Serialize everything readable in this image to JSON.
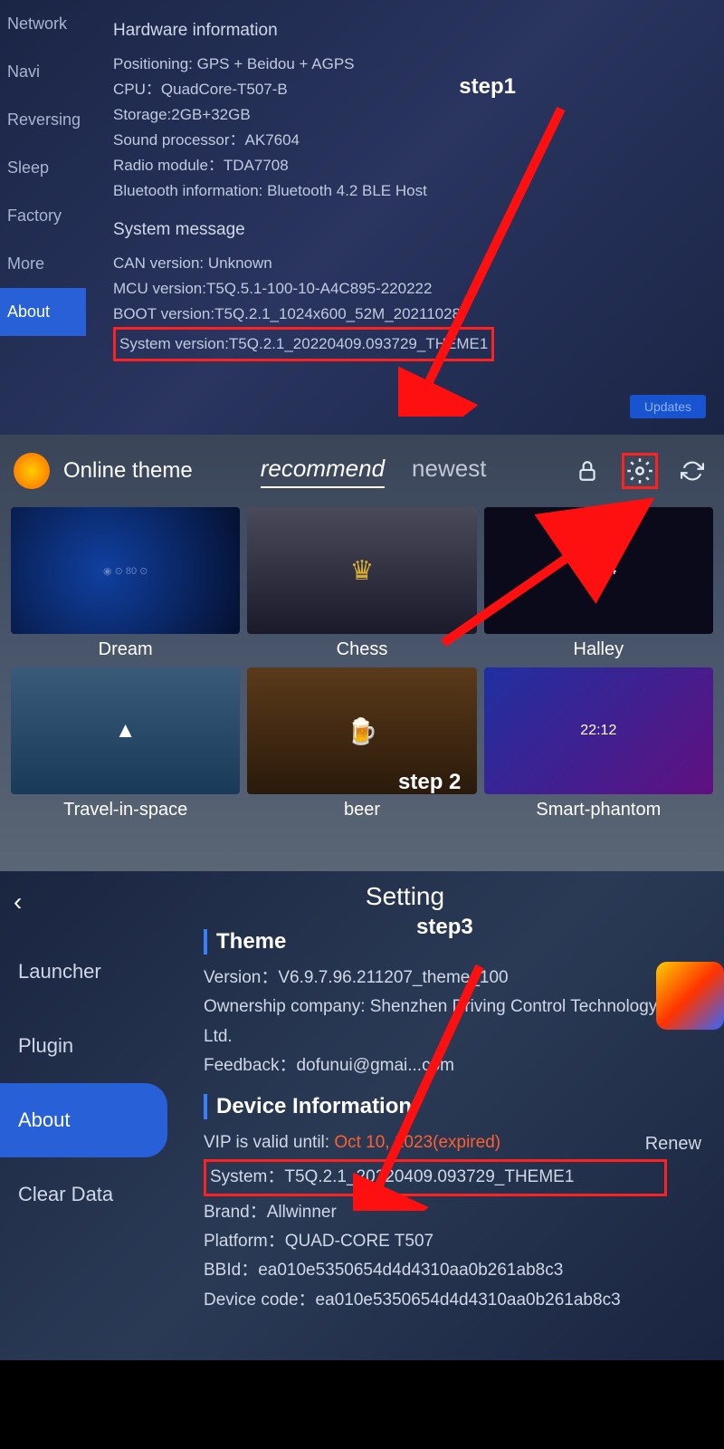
{
  "section1": {
    "sidebar": [
      "Network",
      "Navi",
      "Reversing",
      "Sleep",
      "Factory",
      "More",
      "About"
    ],
    "active_sidebar": "About",
    "hardware_header": "Hardware information",
    "hardware": {
      "positioning": "Positioning: GPS + Beidou + AGPS",
      "cpu": "CPU：QuadCore-T507-B",
      "storage": "Storage:2GB+32GB",
      "sound": "Sound processor：AK7604",
      "radio": "Radio module：TDA7708",
      "bluetooth": "Bluetooth information: Bluetooth 4.2 BLE Host"
    },
    "system_header": "System message",
    "system": {
      "can": "CAN version: Unknown",
      "mcu": "MCU version:T5Q.5.1-100-10-A4C895-220222",
      "boot": "BOOT version:T5Q.2.1_1024x600_52M_20211028",
      "sysver": "System version:T5Q.2.1_20220409.093729_THEME1"
    },
    "updates_btn": "Updates",
    "step_label": "step1"
  },
  "section2": {
    "title": "Online theme",
    "tabs": [
      "recommend",
      "newest"
    ],
    "active_tab": "recommend",
    "themes": [
      "Dream",
      "Chess",
      "Halley",
      "Travel-in-space",
      "beer",
      "Smart-phantom"
    ],
    "step_label": "step 2"
  },
  "section3": {
    "back_icon": "‹",
    "title": "Setting",
    "sidebar": [
      "Launcher",
      "Plugin",
      "About",
      "Clear Data"
    ],
    "active_sidebar": "About",
    "theme_header": "Theme",
    "theme": {
      "version": "Version：V6.9.7.96.211207_theme_100",
      "ownership": "Ownership company: Shenzhen Driving Control Technology Co., Ltd.",
      "feedback": "Feedback：dofunui@gmai...com"
    },
    "device_header": "Device Information",
    "device": {
      "vip_label": "VIP is valid until: ",
      "vip_value": "Oct 10, 2023(expired)",
      "renew": "Renew",
      "system": "System：T5Q.2.1_20220409.093729_THEME1",
      "brand": "Brand：Allwinner",
      "platform": "Platform：QUAD-CORE T507",
      "bbid": "BBId：ea010e5350654d4d4310aa0b261ab8c3",
      "device_code": "Device code：ea010e5350654d4d4310aa0b261ab8c3"
    },
    "step_label": "step3"
  }
}
